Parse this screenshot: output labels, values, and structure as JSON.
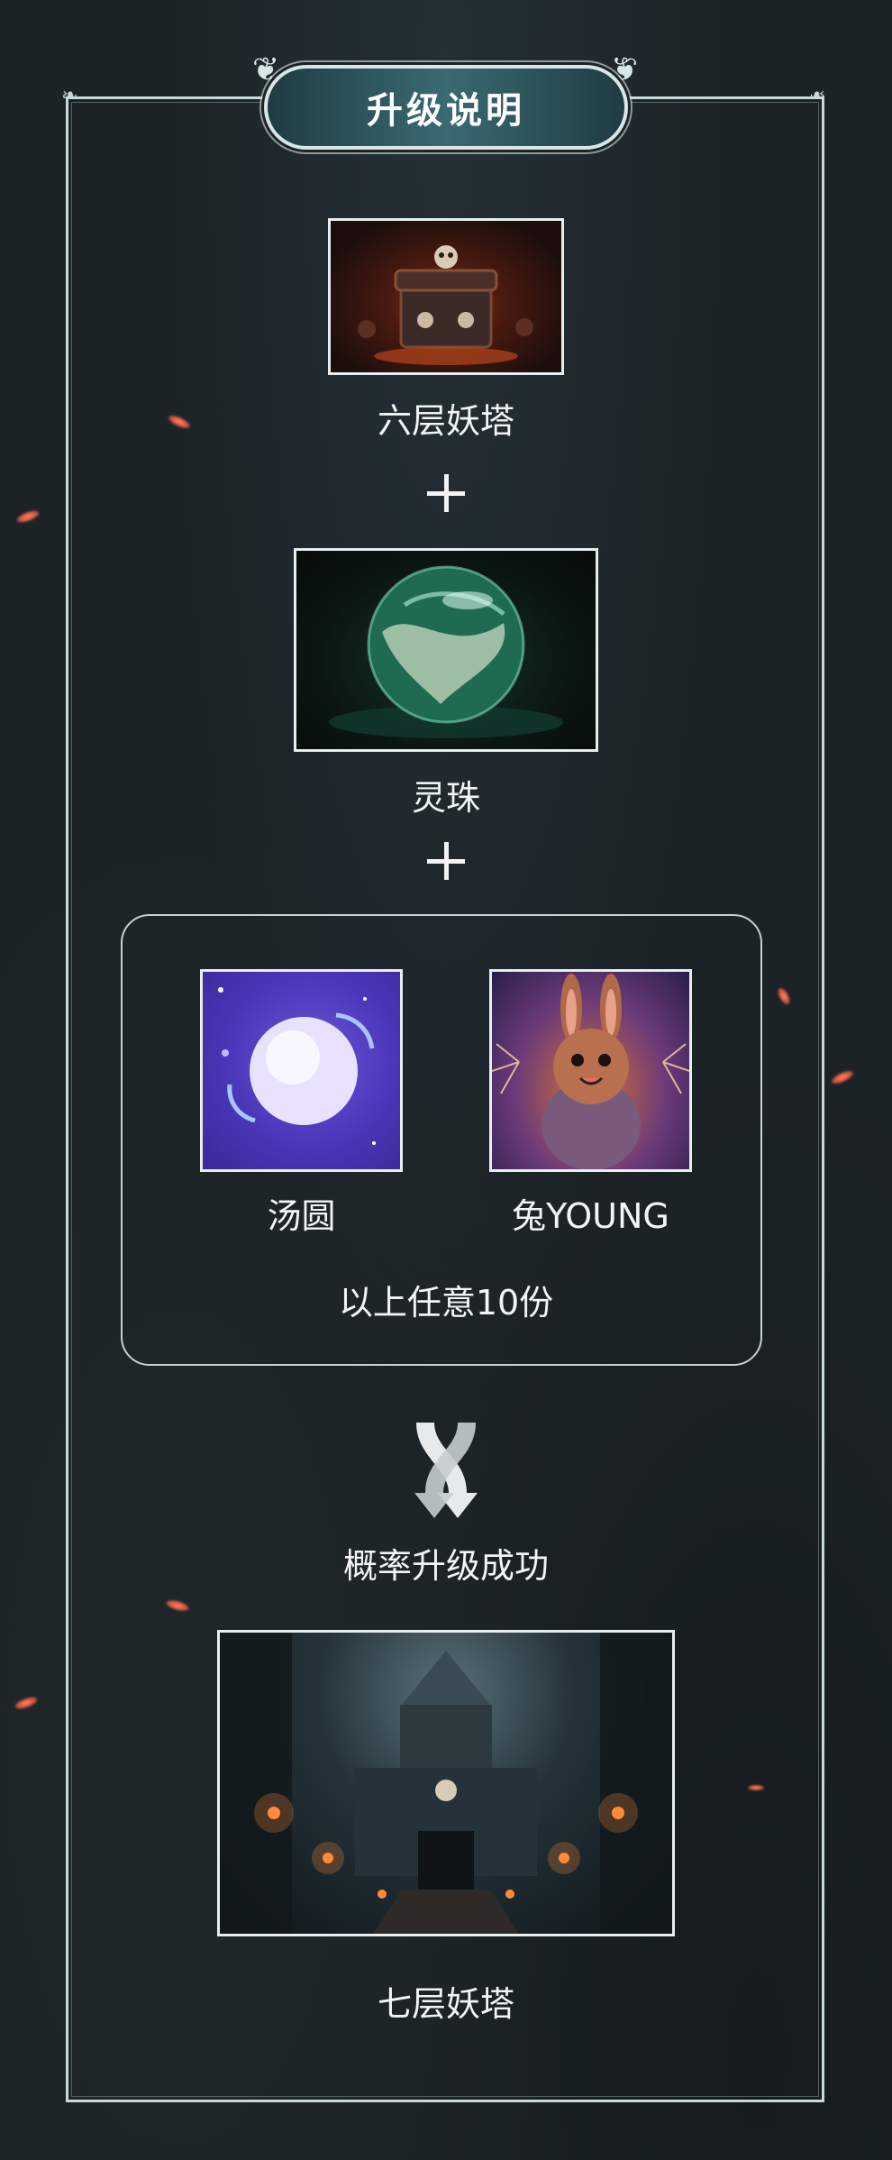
{
  "title": "升级说明",
  "steps": {
    "tower_six": {
      "label": "六层妖塔"
    },
    "spirit_orb": {
      "label": "灵珠"
    },
    "options": [
      {
        "label": "汤圆"
      },
      {
        "label": "兔YOUNG"
      }
    ],
    "options_note": "以上任意10份",
    "result_note": "概率升级成功",
    "tower_seven": {
      "label": "七层妖塔"
    }
  },
  "icons": {
    "plus": "plus-icon",
    "merge": "merge-arrows-icon"
  },
  "colors": {
    "background": "#1c2327",
    "frame": "#c8d8dc",
    "badge": "#3a6a72",
    "ember": "#d2563f"
  }
}
